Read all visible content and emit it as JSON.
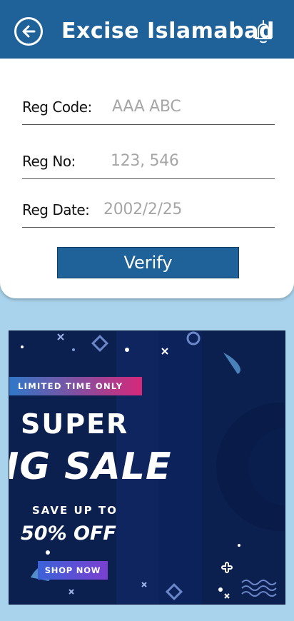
{
  "header": {
    "title": "Excise Islamabad",
    "back_icon": "back-arrow-circle-icon",
    "bell_icon": "bell-icon",
    "background": "#1e6299"
  },
  "form": {
    "fields": [
      {
        "label": "Reg Code:",
        "value": "AAA ABC"
      },
      {
        "label": "Reg No:",
        "value": "123, 546"
      },
      {
        "label": "Reg Date:",
        "value": "2002/2/25"
      }
    ],
    "verify_label": "Verify"
  },
  "banner": {
    "badge": "LIMITED TIME ONLY",
    "line1": "SUPER",
    "line2": "IG SALE",
    "save_text": "SAVE UP TO",
    "discount": "50% OFF",
    "cta": "SHOP NOW"
  },
  "colors": {
    "page_background": "#a9d3ec",
    "accent": "#1e6299",
    "banner_background": "#0c2050"
  }
}
